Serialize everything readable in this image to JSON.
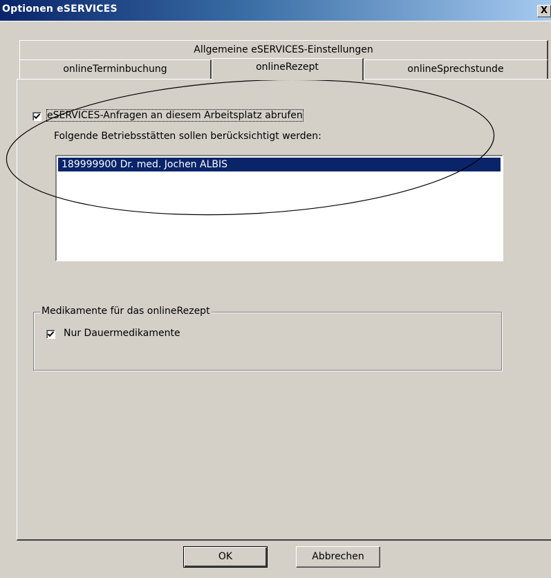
{
  "window": {
    "title": "Optionen eSERVICES",
    "close_glyph": "X"
  },
  "tabs": {
    "row1": "Allgemeine eSERVICES-Einstellungen",
    "row2": [
      "onlineTerminbuchung",
      "onlineRezept",
      "onlineSprechstunde"
    ],
    "active": "onlineRezept"
  },
  "panel": {
    "fetch_checkbox_label": "eSERVICES-Anfragen an diesem Arbeitsplatz abrufen",
    "fetch_checked": true,
    "sites_label": "Folgende  Betriebsstätten sollen berücksichtigt werden:",
    "sites": [
      "189999900 Dr. med. Jochen ALBIS"
    ],
    "group_title": "Medikamente für das onlineRezept",
    "long_term_label": "Nur Dauermedikamente",
    "long_term_checked": true
  },
  "buttons": {
    "ok": "OK",
    "cancel": "Abbrechen"
  },
  "colors": {
    "title_gradient_start": "#0a246a",
    "selection": "#0a246a",
    "dialog_bg": "#d4d0c8"
  }
}
